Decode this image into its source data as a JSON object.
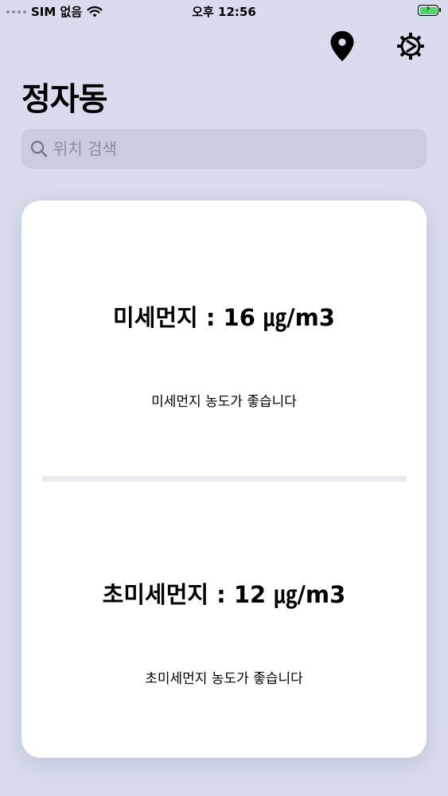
{
  "status_bar": {
    "carrier": "SIM 없음",
    "time": "오후 12:56"
  },
  "header": {
    "location_icon": "location-pin-icon",
    "settings_icon": "gear-icon",
    "title": "정자동"
  },
  "search": {
    "placeholder": "위치 검색",
    "value": ""
  },
  "card": {
    "pm10": {
      "value_text": "미세먼지 : 16 ㎍/m3",
      "description": "미세먼지 농도가 좋습니다"
    },
    "pm25": {
      "value_text": "초미세먼지 : 12 ㎍/m3",
      "description": "초미세먼지 농도가 좋습니다"
    }
  },
  "colors": {
    "background": "#d8dcec",
    "search_background": "#c9cddf",
    "card_background": "#ffffff",
    "battery_fill": "#4cd964"
  }
}
